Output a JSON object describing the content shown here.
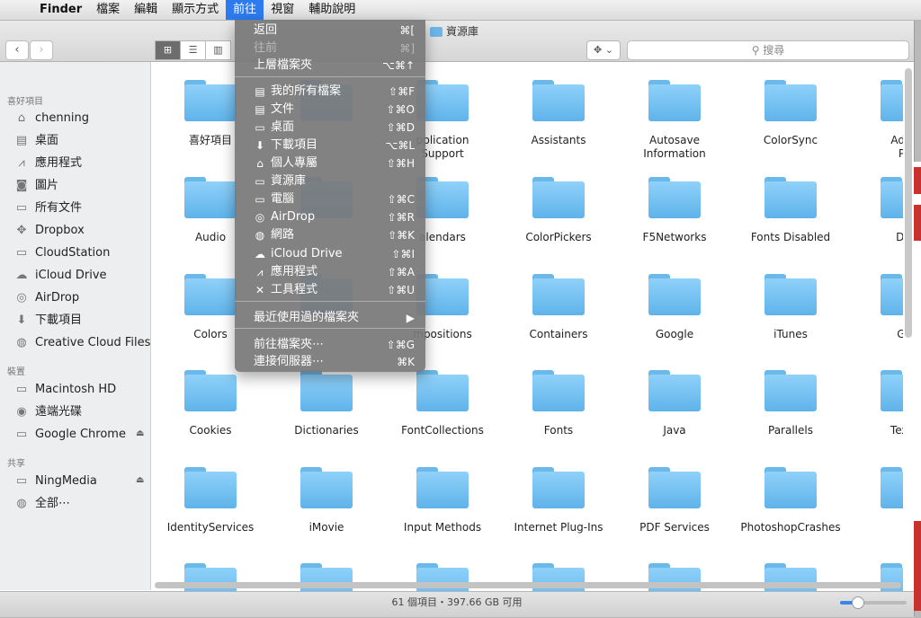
{
  "menubar": {
    "apple": "",
    "items": [
      "Finder",
      "檔案",
      "編輯",
      "顯示方式",
      "前往",
      "視窗",
      "輔助說明"
    ]
  },
  "window": {
    "path_title": "資源庫",
    "search_placeholder": "搜尋",
    "back": "‹",
    "forward": "›",
    "views": [
      "⊞",
      "☰",
      "▥",
      "▦"
    ],
    "dropbox": "✥ ⌄"
  },
  "go_menu": {
    "items": [
      {
        "label": "返回",
        "shortcut": "⌘[",
        "enabled": true,
        "icon": ""
      },
      {
        "label": "往前",
        "shortcut": "⌘]",
        "enabled": false,
        "icon": ""
      },
      {
        "label": "上層檔案夾",
        "shortcut": "⌥⌘↑",
        "enabled": true,
        "icon": ""
      },
      {
        "label": "我的所有檔案",
        "shortcut": "⇧⌘F",
        "enabled": true,
        "icon": "▤"
      },
      {
        "label": "文件",
        "shortcut": "⇧⌘O",
        "enabled": true,
        "icon": "▤"
      },
      {
        "label": "桌面",
        "shortcut": "⇧⌘D",
        "enabled": true,
        "icon": "▭"
      },
      {
        "label": "下載項目",
        "shortcut": "⌥⌘L",
        "enabled": true,
        "icon": "⬇"
      },
      {
        "label": "個人專屬",
        "shortcut": "⇧⌘H",
        "enabled": true,
        "icon": "⌂"
      },
      {
        "label": "資源庫",
        "shortcut": "",
        "enabled": true,
        "icon": "▭"
      },
      {
        "label": "電腦",
        "shortcut": "⇧⌘C",
        "enabled": true,
        "icon": "▭"
      },
      {
        "label": "AirDrop",
        "shortcut": "⇧⌘R",
        "enabled": true,
        "icon": "◎"
      },
      {
        "label": "網路",
        "shortcut": "⇧⌘K",
        "enabled": true,
        "icon": "◍"
      },
      {
        "label": "iCloud Drive",
        "shortcut": "⇧⌘I",
        "enabled": true,
        "icon": "☁"
      },
      {
        "label": "應用程式",
        "shortcut": "⇧⌘A",
        "enabled": true,
        "icon": "⩘"
      },
      {
        "label": "工具程式",
        "shortcut": "⇧⌘U",
        "enabled": true,
        "icon": "✕"
      },
      {
        "label": "最近使用過的檔案夾",
        "shortcut": "▶",
        "enabled": true,
        "icon": ""
      },
      {
        "label": "前往檔案夾⋯",
        "shortcut": "⇧⌘G",
        "enabled": true,
        "icon": ""
      },
      {
        "label": "連接伺服器⋯",
        "shortcut": "⌘K",
        "enabled": true,
        "icon": ""
      }
    ]
  },
  "sidebar": {
    "favorites_header": "喜好項目",
    "favorites": [
      {
        "label": "chenning",
        "icon": "⌂"
      },
      {
        "label": "桌面",
        "icon": "▤"
      },
      {
        "label": "應用程式",
        "icon": "⩘"
      },
      {
        "label": "圖片",
        "icon": "◙"
      },
      {
        "label": "所有文件",
        "icon": "▭"
      },
      {
        "label": "Dropbox",
        "icon": "✥"
      },
      {
        "label": "CloudStation",
        "icon": "▭"
      },
      {
        "label": "iCloud Drive",
        "icon": "☁"
      },
      {
        "label": "AirDrop",
        "icon": "◎"
      },
      {
        "label": "下載項目",
        "icon": "⬇"
      },
      {
        "label": "Creative Cloud Files",
        "icon": "◍"
      }
    ],
    "devices_header": "裝置",
    "devices": [
      {
        "label": "Macintosh HD",
        "icon": "▭",
        "eject": ""
      },
      {
        "label": "遠端光碟",
        "icon": "◉",
        "eject": ""
      },
      {
        "label": "Google Chrome",
        "icon": "▭",
        "eject": "⏏"
      }
    ],
    "shared_header": "共享",
    "shared": [
      {
        "label": "NingMedia",
        "icon": "▭",
        "eject": "⏏"
      },
      {
        "label": "全部⋯",
        "icon": "◍",
        "eject": ""
      }
    ]
  },
  "folders": [
    [
      "喜好項目",
      "Application Support",
      "Assistants",
      "Autosave Information",
      "ColorSync",
      "Address Book Plug-Ins"
    ],
    [
      "Audio",
      "",
      "Calendars",
      "ColorPickers",
      "F5Networks",
      "Fonts Disabled",
      "Developer"
    ],
    [
      "Colors",
      "",
      "Compositions",
      "Containers",
      "Google",
      "iTunes",
      "Gar"
    ],
    [
      "Cookies",
      "Dictionaries",
      "FontCollections",
      "Fonts",
      "Java",
      "Parallels",
      "TextW"
    ],
    [
      "IdentityServices",
      "iMovie",
      "Input Methods",
      "Internet Plug-Ins",
      "PDF Services",
      "PhotoshopCrashes"
    ]
  ],
  "folder_labels_visible": [
    [
      "喜好項目",
      "",
      "pplication\nSupport",
      "Assistants",
      "Autosave\nInformation",
      "ColorSync",
      "Addre\nPlu"
    ],
    [
      "Audio",
      "",
      "alendars",
      "ColorPickers",
      "F5Networks",
      "Fonts Disabled",
      "Dev"
    ],
    [
      "Colors",
      "",
      "mpositions",
      "Containers",
      "Google",
      "iTunes",
      "Gar"
    ],
    [
      "Cookies",
      "Dictionaries",
      "FontCollections",
      "Fonts",
      "Java",
      "Parallels",
      "TextW"
    ],
    [
      "IdentityServices",
      "iMovie",
      "Input Methods",
      "Internet Plug-Ins",
      "PDF Services",
      "PhotoshopCrashes",
      ""
    ]
  ],
  "status": {
    "text": "61 個項目・397.66 GB 可用",
    "zoom_level": 0.25
  },
  "colors": {
    "accent": "#2d7bf0",
    "folder": "#6bb8ea",
    "menu_bg": "#78787a"
  }
}
